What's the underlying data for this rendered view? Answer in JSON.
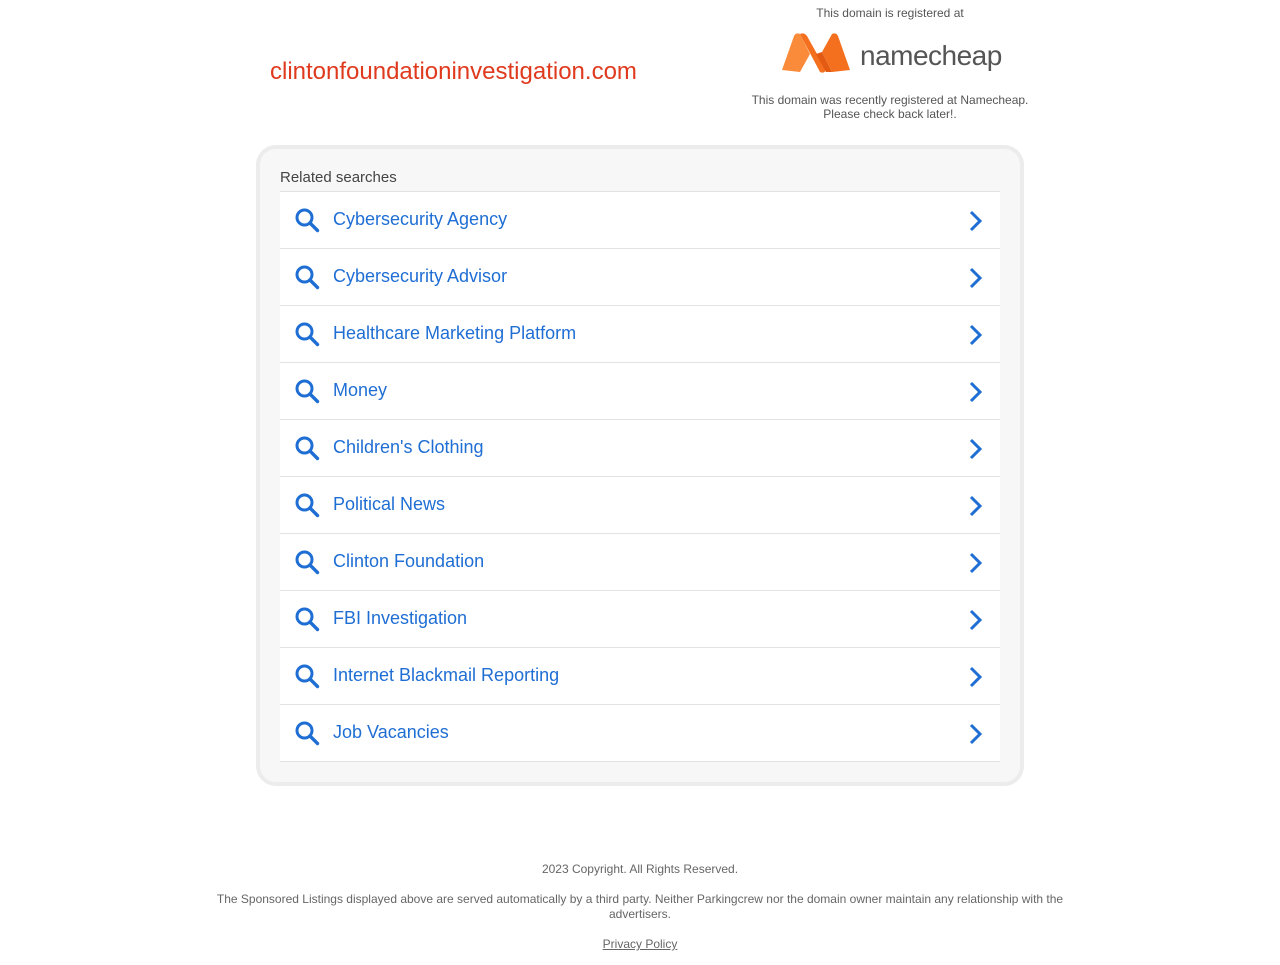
{
  "header": {
    "domain": "clintonfoundationinvestigation.com",
    "registered_at_label": "This domain is registered at",
    "registrar_logo_text": "namecheap",
    "registered_note_line1": "This domain was recently registered at Namecheap.",
    "registered_note_line2": "Please check back later!.",
    "colors": {
      "domain": "#e03a1e",
      "logo_orange": "#f4701f",
      "logo_orange_light": "#fa8b3a"
    }
  },
  "related": {
    "heading": "Related searches",
    "items": [
      {
        "label": "Cybersecurity Agency"
      },
      {
        "label": "Cybersecurity Advisor"
      },
      {
        "label": "Healthcare Marketing Platform"
      },
      {
        "label": "Money"
      },
      {
        "label": "Children's Clothing"
      },
      {
        "label": "Political News"
      },
      {
        "label": "Clinton Foundation"
      },
      {
        "label": "FBI Investigation"
      },
      {
        "label": "Internet Blackmail Reporting"
      },
      {
        "label": "Job Vacancies"
      }
    ],
    "link_color": "#1f6ed4",
    "icons": {
      "leading": "search-icon",
      "trailing": "chevron-right-icon"
    }
  },
  "footer": {
    "copyright": "2023 Copyright. All Rights Reserved.",
    "disclaimer": "The Sponsored Listings displayed above are served automatically by a third party. Neither Parkingcrew nor the domain owner maintain any relationship with the advertisers.",
    "privacy_link": "Privacy Policy"
  }
}
